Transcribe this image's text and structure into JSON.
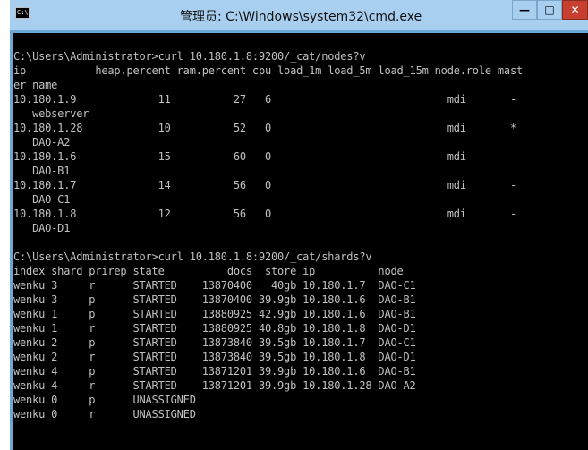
{
  "window": {
    "title": "管理员: C:\\Windows\\system32\\cmd.exe",
    "icon_label": "C:\\",
    "controls": {
      "minimize": "—",
      "maximize": "□",
      "close": "✕"
    }
  },
  "console": {
    "lines": [
      "",
      "C:\\Users\\Administrator>curl 10.180.1.8:9200/_cat/nodes?v",
      "ip           heap.percent ram.percent cpu load_1m load_5m load_15m node.role mast",
      "er name",
      "10.180.1.9             11          27   6                            mdi       -",
      "   webserver",
      "10.180.1.28            10          52   0                            mdi       *",
      "   DAO-A2",
      "10.180.1.6             15          60   0                            mdi       -",
      "   DAO-B1",
      "10.180.1.7             14          56   0                            mdi       -",
      "   DAO-C1",
      "10.180.1.8             12          56   0                            mdi       -",
      "   DAO-D1",
      "",
      "C:\\Users\\Administrator>curl 10.180.1.8:9200/_cat/shards?v",
      "index shard prirep state          docs  store ip          node",
      "wenku 3     r      STARTED    13870400   40gb 10.180.1.7  DAO-C1",
      "wenku 3     p      STARTED    13870400 39.9gb 10.180.1.6  DAO-B1",
      "wenku 1     p      STARTED    13880925 42.9gb 10.180.1.6  DAO-B1",
      "wenku 1     r      STARTED    13880925 40.8gb 10.180.1.8  DAO-D1",
      "wenku 2     p      STARTED    13873840 39.5gb 10.180.1.7  DAO-C1",
      "wenku 2     r      STARTED    13873840 39.5gb 10.180.1.8  DAO-D1",
      "wenku 4     p      STARTED    13871201 39.9gb 10.180.1.6  DAO-B1",
      "wenku 4     r      STARTED    13871201 39.9gb 10.180.1.28 DAO-A2",
      "wenku 0     p      UNASSIGNED",
      "wenku 0     r      UNASSIGNED",
      "",
      ""
    ],
    "prompt": "C:\\Users\\Administrator>"
  },
  "colors": {
    "console_bg": "#000000",
    "console_fg": "#c0c0c0",
    "titlebar": "#a9cff0",
    "close_button": "#c7402f"
  }
}
